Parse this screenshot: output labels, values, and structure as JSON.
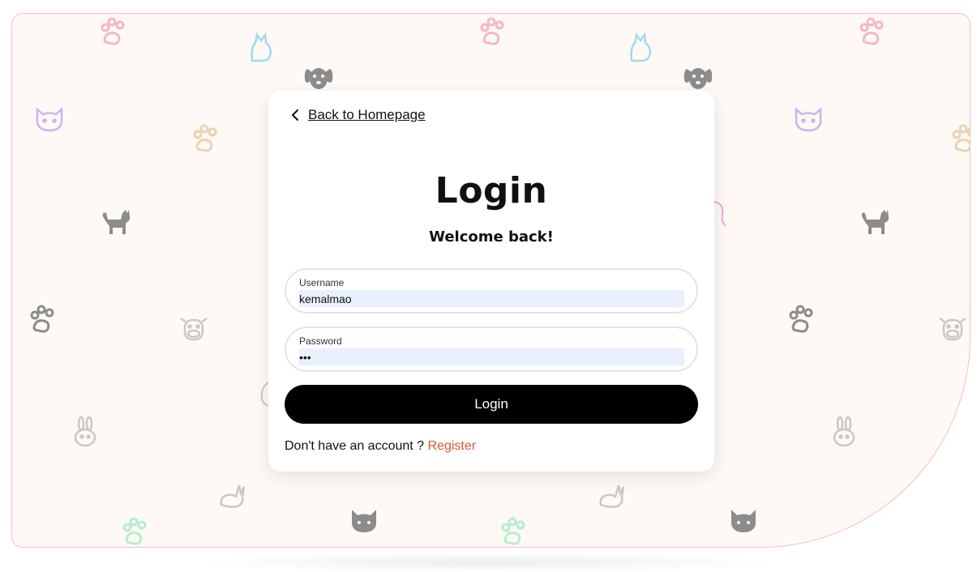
{
  "nav": {
    "back_label": " Back to Homepage"
  },
  "login_form": {
    "title": "Login",
    "subtitle": "Welcome back!",
    "username": {
      "label": "Username",
      "value": "kemalmao"
    },
    "password": {
      "label": "Password",
      "value": "•••"
    },
    "submit_label": "Login",
    "register_prompt": "Don't have an account ?",
    "register_link": "Register"
  },
  "theme": {
    "background": "#fef9f5",
    "frame_border": "#f2c2bc",
    "button": "#000000",
    "link_accent": "#d9573a",
    "autofill": "#e8f0fe"
  },
  "background_pattern": {
    "icons": [
      "paw-icon",
      "cat-head-icon",
      "dog-head-icon",
      "cat-sitting-icon",
      "cow-head-icon",
      "bunny-icon",
      "rabbit-icon",
      "bird-icon"
    ],
    "colors": [
      "#f4b8c1",
      "#9fdaf2",
      "#8c8c8c",
      "#c9b6ef",
      "#e8d3b4",
      "#c8c8c8",
      "#b7ecd0"
    ]
  }
}
